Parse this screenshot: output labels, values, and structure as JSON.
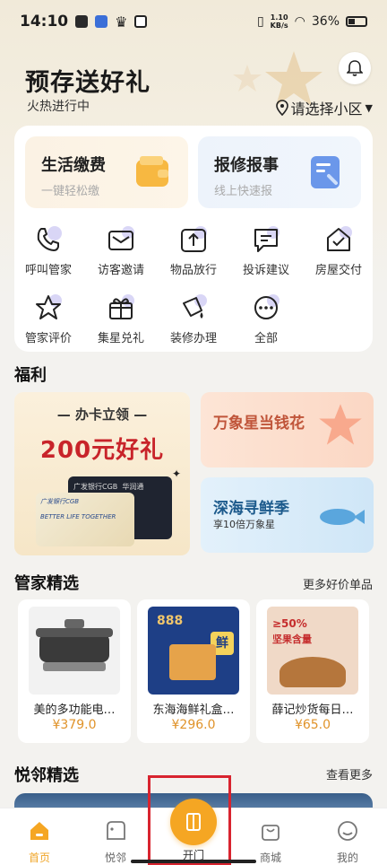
{
  "status_bar": {
    "time": "14:10",
    "speed_value": "1.10",
    "speed_unit": "KB/s",
    "battery": "36%"
  },
  "header": {
    "title": "预存送好礼",
    "subtitle": "火热进行中",
    "community_selector": "请选择小区"
  },
  "service_cards": [
    {
      "title": "生活缴费",
      "subtitle": "一键轻松缴"
    },
    {
      "title": "报修报事",
      "subtitle": "线上快速报"
    }
  ],
  "quick_actions": [
    {
      "label": "呼叫管家",
      "icon": "phone-icon"
    },
    {
      "label": "访客邀请",
      "icon": "mail-icon"
    },
    {
      "label": "物品放行",
      "icon": "upload-icon"
    },
    {
      "label": "投诉建议",
      "icon": "chat-icon"
    },
    {
      "label": "房屋交付",
      "icon": "house-check-icon"
    },
    {
      "label": "管家评价",
      "icon": "star-icon"
    },
    {
      "label": "集星兑礼",
      "icon": "gift-icon"
    },
    {
      "label": "装修办理",
      "icon": "paint-bucket-icon"
    },
    {
      "label": "全部",
      "icon": "more-icon"
    }
  ],
  "welfare": {
    "title": "福利",
    "big_promo": {
      "line1": "办卡立领",
      "line2": "200元好礼",
      "card_text_1": "广发银行CGB",
      "card_text_2": "华润通",
      "card_slogan": "BETTER LIFE TOGETHER"
    },
    "promos": [
      {
        "title": "万象星当钱花",
        "subtitle": ""
      },
      {
        "title": "深海寻鲜季",
        "subtitle": "享10倍万象星"
      }
    ]
  },
  "butler_picks": {
    "title": "管家精选",
    "more": "更多好价单品",
    "products": [
      {
        "name": "美的多功能电…",
        "price": "¥379.0"
      },
      {
        "name": "东海海鲜礼盒…",
        "price": "¥296.0",
        "badge": "888",
        "tag": "鲜"
      },
      {
        "name": "薛记炒货每日…",
        "price": "¥65.0",
        "badge": "≥50%",
        "tag": "坚果含量"
      }
    ]
  },
  "neighbor_picks": {
    "title": "悦邻精选",
    "more": "查看更多"
  },
  "tab_bar": [
    {
      "label": "首页"
    },
    {
      "label": "悦邻"
    },
    {
      "label": "开门"
    },
    {
      "label": "商城"
    },
    {
      "label": "我的"
    }
  ],
  "colors": {
    "accent": "#f5a623",
    "price": "#e0932a",
    "highlight": "#d8242f"
  }
}
